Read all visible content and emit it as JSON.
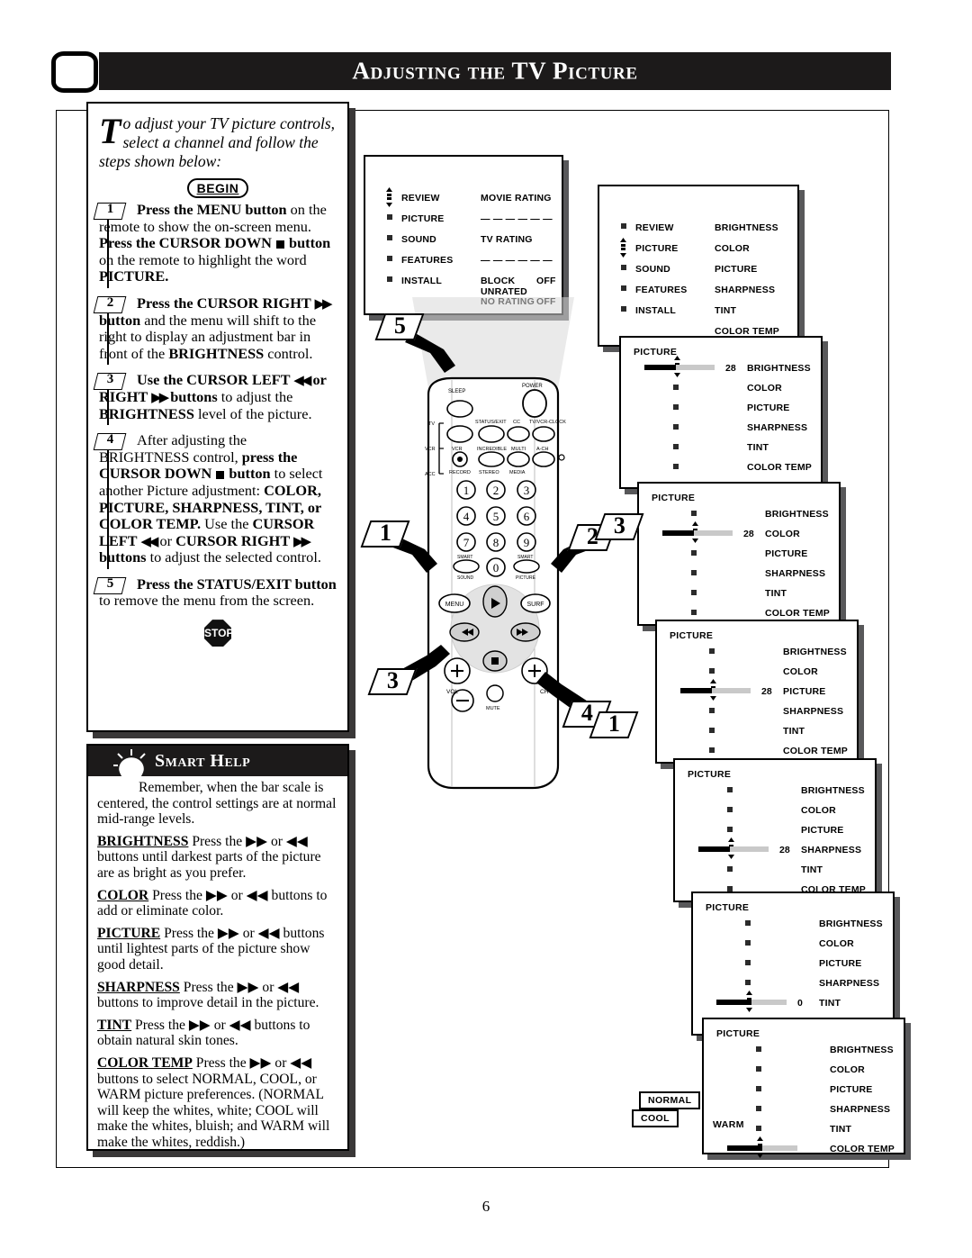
{
  "header": {
    "title": "Adjusting the TV Picture",
    "tv_icon": "tv-screen-icon"
  },
  "intro": {
    "dropcap": "T",
    "text": "o adjust your TV picture controls, select a channel and follow the steps shown below:"
  },
  "begin_label": "BEGIN",
  "stop_label": "STOP",
  "steps": [
    {
      "num": "1",
      "parts": [
        {
          "t": "Press the MENU button",
          "b": true
        },
        {
          "t": " on the remote to show the on-screen menu. ",
          "b": false
        },
        {
          "t": "Press the CURSOR DOWN ",
          "b": true
        },
        {
          "t": "■",
          "b": true,
          "sq": true
        },
        {
          "t": " button",
          "b": true
        },
        {
          "t": " on the remote to highlight the word ",
          "b": false
        },
        {
          "t": "PICTURE.",
          "b": true
        }
      ]
    },
    {
      "num": "2",
      "parts": [
        {
          "t": "Press the CURSOR RIGHT ",
          "b": true
        },
        {
          "t": "▶▶",
          "b": true,
          "arrow": true
        },
        {
          "t": " button",
          "b": true
        },
        {
          "t": " and the menu will shift to the right to display an adjustment bar in front of the ",
          "b": false
        },
        {
          "t": "BRIGHTNESS",
          "b": true
        },
        {
          "t": " control.",
          "b": false
        }
      ]
    },
    {
      "num": "3",
      "parts": [
        {
          "t": "Use the CURSOR LEFT ",
          "b": true
        },
        {
          "t": "◀◀",
          "b": true,
          "arrow": true
        },
        {
          "t": " or RIGHT ",
          "b": true
        },
        {
          "t": "▶▶",
          "b": true,
          "arrow": true
        },
        {
          "t": " buttons",
          "b": true
        },
        {
          "t": " to adjust the ",
          "b": false
        },
        {
          "t": "BRIGHTNESS",
          "b": true
        },
        {
          "t": " level of the picture.",
          "b": false
        }
      ]
    },
    {
      "num": "4",
      "parts": [
        {
          "t": "After adjusting the BRIGHTNESS control, ",
          "b": false
        },
        {
          "t": "press the CURSOR DOWN ",
          "b": true
        },
        {
          "t": "■",
          "b": true,
          "sq": true
        },
        {
          "t": " button",
          "b": true
        },
        {
          "t": " to select another Picture adjustment: ",
          "b": false
        },
        {
          "t": "COLOR, PICTURE, SHARPNESS, TINT, or COLOR TEMP.",
          "b": true
        },
        {
          "t": " Use the ",
          "b": false
        },
        {
          "t": "CURSOR LEFT ",
          "b": true
        },
        {
          "t": "◀◀",
          "b": true,
          "arrow": true
        },
        {
          "t": " or ",
          "b": false
        },
        {
          "t": "CURSOR RIGHT ",
          "b": true
        },
        {
          "t": "▶▶",
          "b": true,
          "arrow": true
        },
        {
          "t": " buttons",
          "b": true
        },
        {
          "t": " to adjust the selected control.",
          "b": false
        }
      ]
    },
    {
      "num": "5",
      "parts": [
        {
          "t": "Press the STATUS/EXIT button",
          "b": true
        },
        {
          "t": " to remove the menu from the screen.",
          "b": false
        }
      ]
    }
  ],
  "smart_help": {
    "title": "Smart Help",
    "intro": "Remember, when the bar scale is centered, the control settings are at normal mid-range levels.",
    "entries": [
      {
        "term": "BRIGHTNESS",
        "text": "Press the ▶▶ or ◀◀ buttons until darkest parts of the picture are as bright as you prefer."
      },
      {
        "term": "COLOR",
        "text": "Press the ▶▶ or ◀◀ buttons to add or eliminate color."
      },
      {
        "term": "PICTURE",
        "text": "Press the ▶▶ or ◀◀ buttons until lightest parts of the picture show good detail."
      },
      {
        "term": "SHARPNESS",
        "text": "Press the ▶▶ or ◀◀ buttons to improve detail in the picture."
      },
      {
        "term": "TINT",
        "text": "Press the ▶▶ or ◀◀ buttons to obtain natural skin tones."
      },
      {
        "term": "COLOR TEMP",
        "text": "Press the ▶▶ or ◀◀ buttons to select NORMAL, COOL, or WARM picture preferences. (NORMAL will keep the whites, white; COOL will make the whites, bluish; and WARM will make the whites, reddish.)"
      }
    ]
  },
  "osd_screens": [
    {
      "id": "ratings-menu",
      "left_items": [
        "REVIEW",
        "PICTURE",
        "SOUND",
        "FEATURES",
        "INSTALL"
      ],
      "highlight_index": 0,
      "right_items": [
        {
          "label": "MOVIE RATING",
          "value": ""
        },
        {
          "label": "— — — — — —",
          "value": ""
        },
        {
          "label": "TV RATING",
          "value": ""
        },
        {
          "label": "— — — — — —",
          "value": ""
        },
        {
          "label": "BLOCK UNRATED",
          "value": "OFF"
        },
        {
          "label": "NO RATING",
          "value": "OFF"
        }
      ]
    },
    {
      "id": "picture-menu",
      "left_items": [
        "REVIEW",
        "PICTURE",
        "SOUND",
        "FEATURES",
        "INSTALL"
      ],
      "highlight_index": 1,
      "right_items": [
        {
          "label": "BRIGHTNESS"
        },
        {
          "label": "COLOR"
        },
        {
          "label": "PICTURE"
        },
        {
          "label": "SHARPNESS"
        },
        {
          "label": "TINT"
        },
        {
          "label": "COLOR TEMP"
        }
      ]
    },
    {
      "id": "brightness-adjust",
      "title": "PICTURE",
      "selected": "BRIGHTNESS",
      "selected_index": 0,
      "value": "28",
      "items": [
        "BRIGHTNESS",
        "COLOR",
        "PICTURE",
        "SHARPNESS",
        "TINT",
        "COLOR TEMP"
      ]
    },
    {
      "id": "color-adjust",
      "title": "PICTURE",
      "selected": "COLOR",
      "selected_index": 1,
      "value": "28",
      "items": [
        "BRIGHTNESS",
        "COLOR",
        "PICTURE",
        "SHARPNESS",
        "TINT",
        "COLOR TEMP"
      ]
    },
    {
      "id": "picture-adjust",
      "title": "PICTURE",
      "selected": "PICTURE",
      "selected_index": 2,
      "value": "28",
      "items": [
        "BRIGHTNESS",
        "COLOR",
        "PICTURE",
        "SHARPNESS",
        "TINT",
        "COLOR TEMP"
      ]
    },
    {
      "id": "sharpness-adjust",
      "title": "PICTURE",
      "selected": "SHARPNESS",
      "selected_index": 3,
      "value": "28",
      "items": [
        "BRIGHTNESS",
        "COLOR",
        "PICTURE",
        "SHARPNESS",
        "TINT",
        "COLOR TEMP"
      ]
    },
    {
      "id": "tint-adjust",
      "title": "PICTURE",
      "selected": "TINT",
      "selected_index": 4,
      "value": "0",
      "items": [
        "BRIGHTNESS",
        "COLOR",
        "PICTURE",
        "SHARPNESS",
        "TINT",
        "COLOR TEMP"
      ]
    },
    {
      "id": "colortemp-adjust",
      "title": "PICTURE",
      "selected": "COLOR TEMP",
      "selected_index": 5,
      "value": "",
      "items": [
        "BRIGHTNESS",
        "COLOR",
        "PICTURE",
        "SHARPNESS",
        "TINT",
        "COLOR TEMP"
      ],
      "options": [
        "NORMAL",
        "COOL",
        "WARM"
      ]
    }
  ],
  "remote": {
    "top_labels": [
      "SLEEP",
      "POWER"
    ],
    "row_labels": [
      "STATUS/EXIT",
      "CC",
      "TV/VCR-CLOCK"
    ],
    "mode_labels": [
      "TV",
      "VCR",
      "ACC"
    ],
    "fn_labels": [
      "VCR",
      "INCREDIBLE",
      "MULTI",
      "A-CH"
    ],
    "fn_sub_labels": [
      "RECORD",
      "STEREO",
      "MEDIA"
    ],
    "keys": [
      "1",
      "2",
      "3",
      "4",
      "5",
      "6",
      "7",
      "8",
      "9",
      "0"
    ],
    "smart_sound": "SMART SOUND",
    "smart_picture": "SMART PICTURE",
    "menu": "MENU",
    "surf": "SURF",
    "vol": "VOL",
    "ch": "CH",
    "mute": "MUTE",
    "callouts": [
      "1",
      "2",
      "3",
      "3",
      "4",
      "5",
      "1"
    ]
  },
  "page_number": "6"
}
